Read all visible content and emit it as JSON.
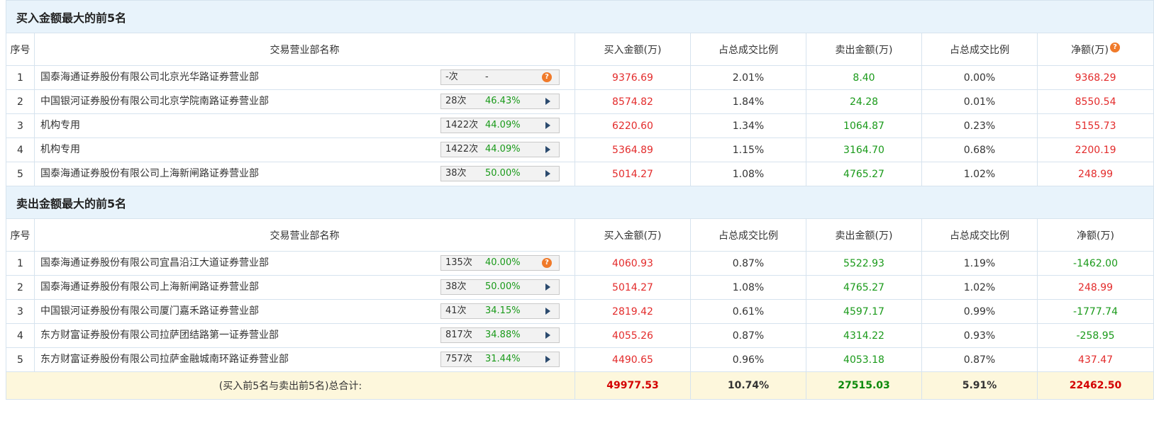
{
  "headers": {
    "idx": "序号",
    "name": "交易营业部名称",
    "buy": "买入金额(万)",
    "buy_ratio": "占总成交比例",
    "sell": "卖出金额(万)",
    "sell_ratio": "占总成交比例",
    "net": "净额(万)"
  },
  "help_glyph": "?",
  "buy_section": {
    "title": "买入金额最大的前5名",
    "rows": [
      {
        "idx": "1",
        "name": "国泰海通证券股份有限公司北京光华路证券营业部",
        "count": "-次",
        "pct": "-",
        "buy": "9376.69",
        "buy_ratio": "2.01%",
        "sell": "8.40",
        "sell_ratio": "0.00%",
        "net": "9368.29"
      },
      {
        "idx": "2",
        "name": "中国银河证券股份有限公司北京学院南路证券营业部",
        "count": "28次",
        "pct": "46.43%",
        "buy": "8574.82",
        "buy_ratio": "1.84%",
        "sell": "24.28",
        "sell_ratio": "0.01%",
        "net": "8550.54"
      },
      {
        "idx": "3",
        "name": "机构专用",
        "count": "1422次",
        "pct": "44.09%",
        "buy": "6220.60",
        "buy_ratio": "1.34%",
        "sell": "1064.87",
        "sell_ratio": "0.23%",
        "net": "5155.73"
      },
      {
        "idx": "4",
        "name": "机构专用",
        "count": "1422次",
        "pct": "44.09%",
        "buy": "5364.89",
        "buy_ratio": "1.15%",
        "sell": "3164.70",
        "sell_ratio": "0.68%",
        "net": "2200.19"
      },
      {
        "idx": "5",
        "name": "国泰海通证券股份有限公司上海新闸路证券营业部",
        "count": "38次",
        "pct": "50.00%",
        "buy": "5014.27",
        "buy_ratio": "1.08%",
        "sell": "4765.27",
        "sell_ratio": "1.02%",
        "net": "248.99"
      }
    ]
  },
  "sell_section": {
    "title": "卖出金额最大的前5名",
    "rows": [
      {
        "idx": "1",
        "name": "国泰海通证券股份有限公司宜昌沿江大道证券营业部",
        "count": "135次",
        "pct": "40.00%",
        "buy": "4060.93",
        "buy_ratio": "0.87%",
        "sell": "5522.93",
        "sell_ratio": "1.19%",
        "net": "-1462.00"
      },
      {
        "idx": "2",
        "name": "国泰海通证券股份有限公司上海新闸路证券营业部",
        "count": "38次",
        "pct": "50.00%",
        "buy": "5014.27",
        "buy_ratio": "1.08%",
        "sell": "4765.27",
        "sell_ratio": "1.02%",
        "net": "248.99"
      },
      {
        "idx": "3",
        "name": "中国银河证券股份有限公司厦门嘉禾路证券营业部",
        "count": "41次",
        "pct": "34.15%",
        "buy": "2819.42",
        "buy_ratio": "0.61%",
        "sell": "4597.17",
        "sell_ratio": "0.99%",
        "net": "-1777.74"
      },
      {
        "idx": "4",
        "name": "东方财富证券股份有限公司拉萨团结路第一证券营业部",
        "count": "817次",
        "pct": "34.88%",
        "buy": "4055.26",
        "buy_ratio": "0.87%",
        "sell": "4314.22",
        "sell_ratio": "0.93%",
        "net": "-258.95"
      },
      {
        "idx": "5",
        "name": "东方财富证券股份有限公司拉萨金融城南环路证券营业部",
        "count": "757次",
        "pct": "31.44%",
        "buy": "4490.65",
        "buy_ratio": "0.96%",
        "sell": "4053.18",
        "sell_ratio": "0.87%",
        "net": "437.47"
      }
    ]
  },
  "total": {
    "label": "(买入前5名与卖出前5名)总合计:",
    "buy": "49977.53",
    "buy_ratio": "10.74%",
    "sell": "27515.03",
    "sell_ratio": "5.91%",
    "net": "22462.50"
  },
  "colors": {
    "positive": "#e32b2b",
    "negative": "#1a9a1a",
    "header_bg": "#e8f3fb",
    "total_bg": "#fdf7dc"
  }
}
